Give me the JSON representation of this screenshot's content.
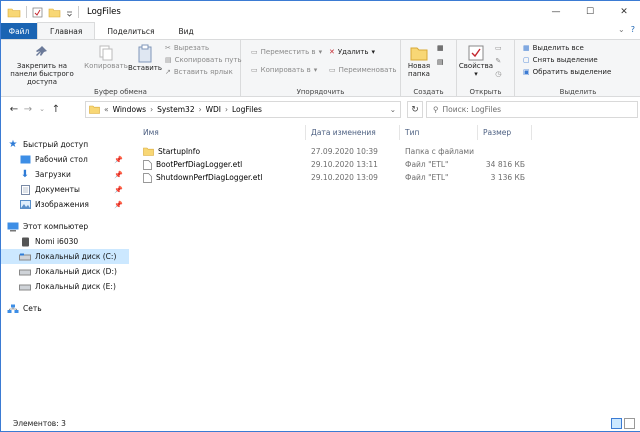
{
  "window": {
    "title": "LogFiles"
  },
  "tabs": {
    "file": "Файл",
    "home": "Главная",
    "share": "Поделиться",
    "view": "Вид"
  },
  "ribbon": {
    "clipboard": {
      "label": "Буфер обмена",
      "pin": "Закрепить на панели быстрого доступа",
      "copy": "Копировать",
      "paste": "Вставить",
      "cut": "Вырезать",
      "copy_path": "Скопировать путь",
      "paste_shortcut": "Вставить ярлык"
    },
    "organize": {
      "label": "Упорядочить",
      "move": "Переместить в",
      "copy_to": "Копировать в",
      "delete": "Удалить",
      "rename": "Переименовать"
    },
    "create": {
      "label": "Создать",
      "new_folder": "Новая папка"
    },
    "open": {
      "label": "Открыть",
      "properties": "Свойства"
    },
    "select": {
      "label": "Выделить",
      "select_all": "Выделить все",
      "select_none": "Снять выделение",
      "invert": "Обратить выделение"
    }
  },
  "address": {
    "crumbs": [
      "Windows",
      "System32",
      "WDI",
      "LogFiles"
    ],
    "prefix": "«"
  },
  "search": {
    "placeholder": "Поиск: LogFiles"
  },
  "nav": {
    "quick_access": "Быстрый доступ",
    "desktop": "Рабочий стол",
    "downloads": "Загрузки",
    "documents": "Документы",
    "pictures": "Изображения",
    "this_pc": "Этот компьютер",
    "nomi": "Nomi i6030",
    "disk_c": "Локальный диск (C:)",
    "disk_d": "Локальный диск (D:)",
    "disk_e": "Локальный диск (E:)",
    "network": "Сеть"
  },
  "columns": {
    "name": "Имя",
    "date": "Дата изменения",
    "type": "Тип",
    "size": "Размер"
  },
  "files": [
    {
      "name": "StartupInfo",
      "date": "27.09.2020 10:39",
      "type": "Папка с файлами",
      "size": "",
      "icon": "folder-icon"
    },
    {
      "name": "BootPerfDiagLogger.etl",
      "date": "29.10.2020 13:11",
      "type": "Файл \"ETL\"",
      "size": "34 816 КБ",
      "icon": "file-icon"
    },
    {
      "name": "ShutdownPerfDiagLogger.etl",
      "date": "29.10.2020 13:09",
      "type": "Файл \"ETL\"",
      "size": "3 136 КБ",
      "icon": "file-icon"
    }
  ],
  "status": {
    "items": "Элементов: 3"
  },
  "colors": {
    "accent": "#1a64b3",
    "selection": "#cce8ff",
    "folder": "#f8d775"
  }
}
